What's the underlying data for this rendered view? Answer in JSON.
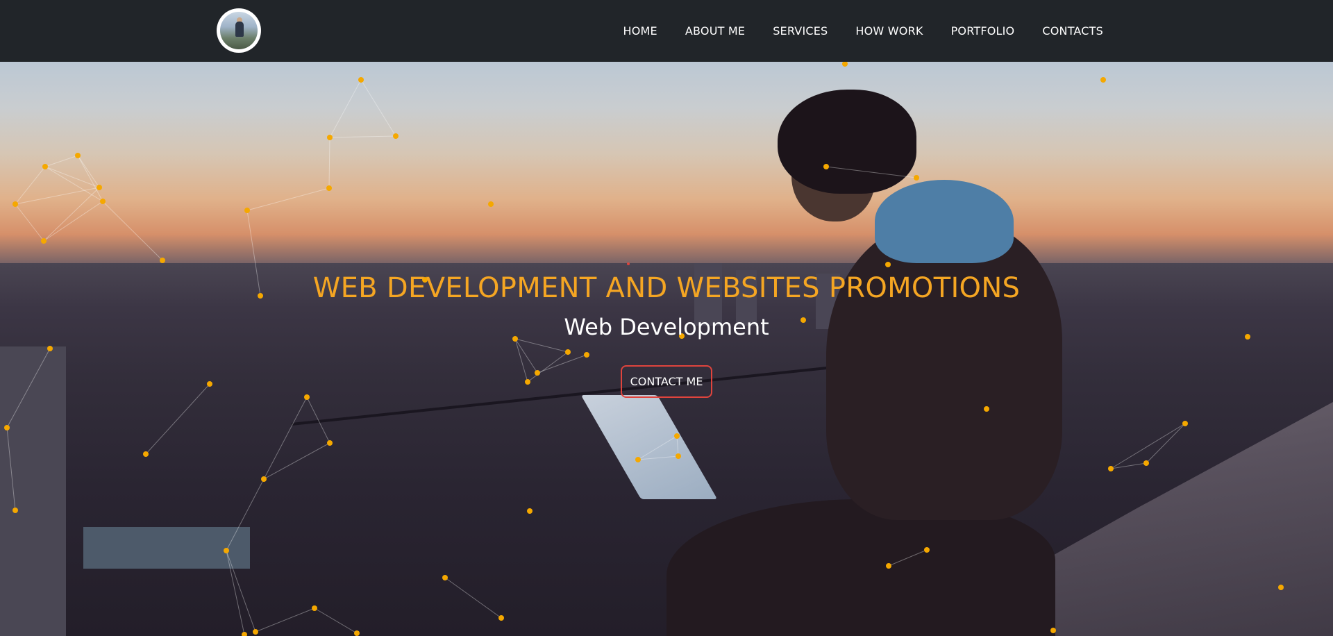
{
  "header": {
    "logo_alt": "profile-photo",
    "nav": [
      {
        "label": "HOME"
      },
      {
        "label": "ABOUT ME"
      },
      {
        "label": "SERVICES"
      },
      {
        "label": "HOW WORK"
      },
      {
        "label": "PORTFOLIO"
      },
      {
        "label": "CONTACTS"
      }
    ]
  },
  "hero": {
    "title": "WEB DEVELOPMENT AND WEBSITES PROMOTIONS",
    "subtitle": "Web Development",
    "cta_label": "CONTACT ME"
  },
  "colors": {
    "navbar_bg": "#212529",
    "accent": "#f5a623",
    "cta_border": "#e0443d",
    "particle": "#f5a800"
  }
}
